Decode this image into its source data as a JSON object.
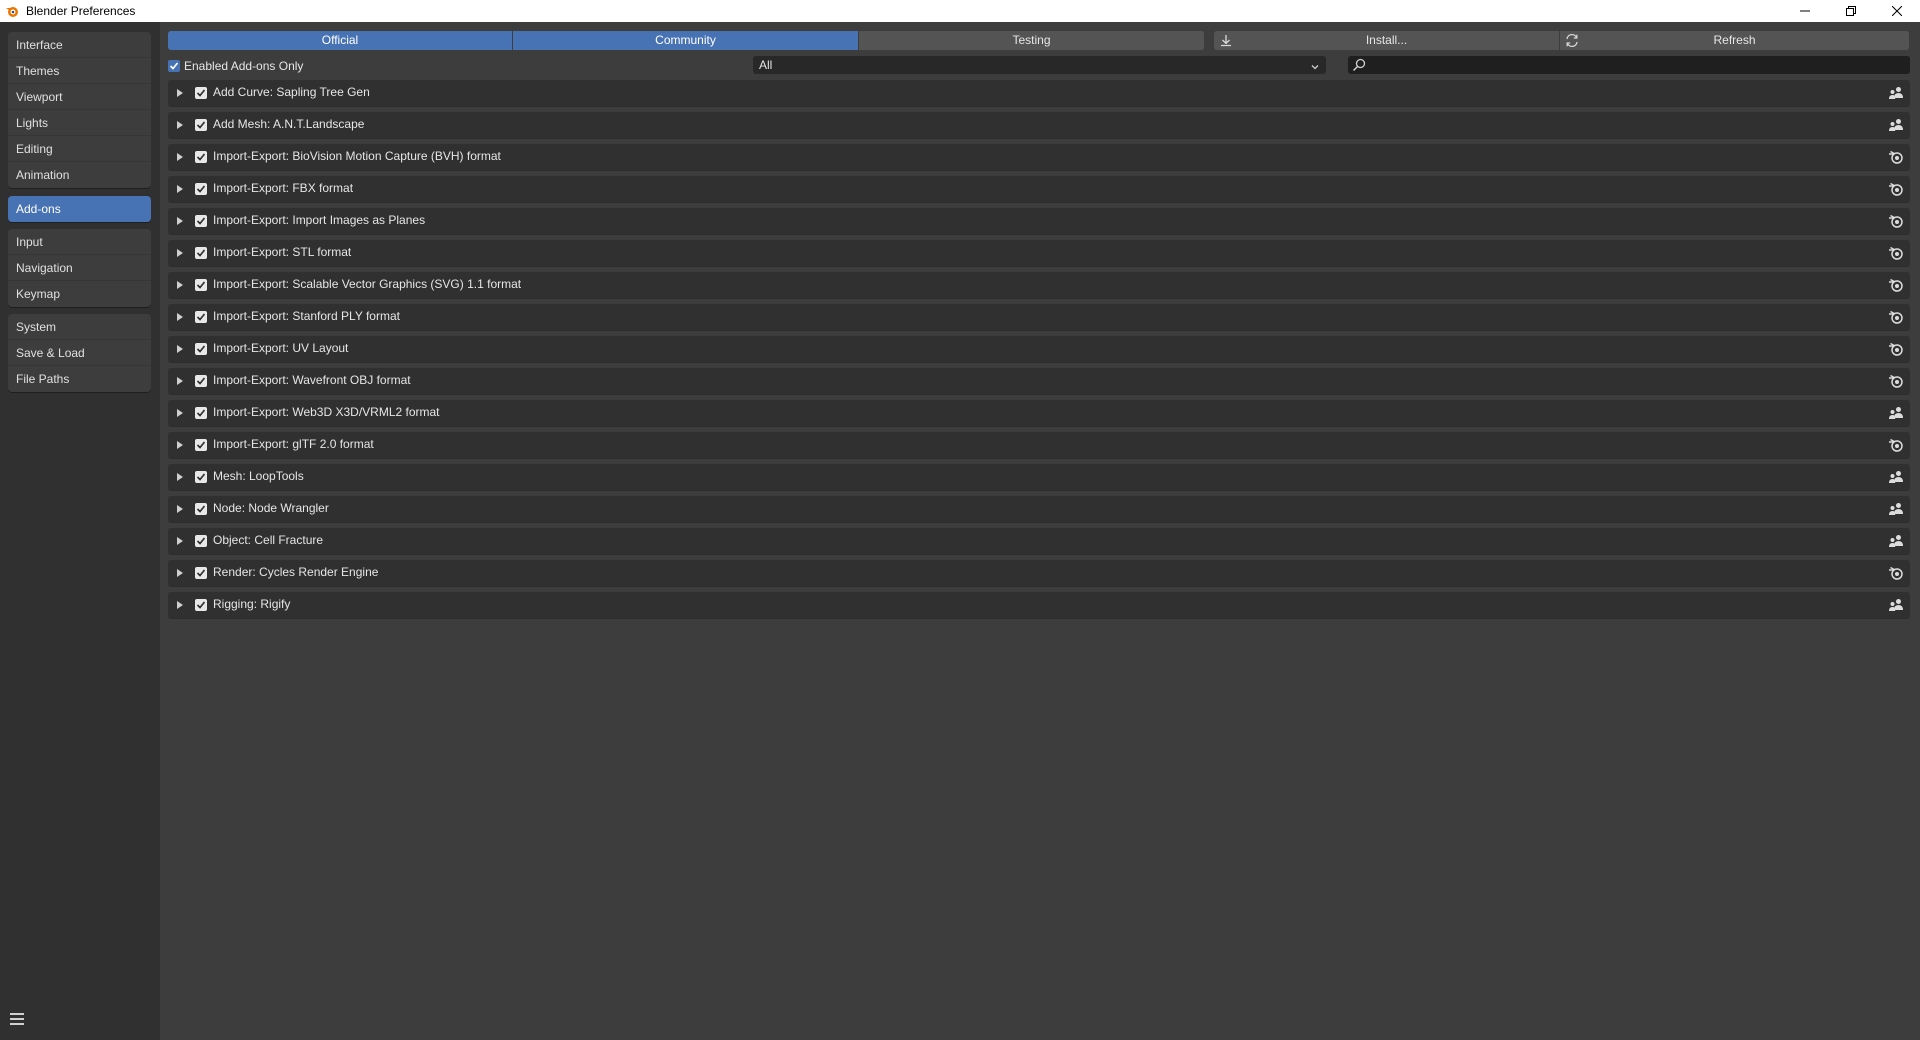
{
  "window": {
    "title": "Blender Preferences"
  },
  "sidebar": {
    "groups": [
      [
        "Interface",
        "Themes",
        "Viewport",
        "Lights",
        "Editing",
        "Animation"
      ],
      [
        "Add-ons"
      ],
      [
        "Input",
        "Navigation",
        "Keymap"
      ],
      [
        "System",
        "Save & Load",
        "File Paths"
      ]
    ],
    "active": "Add-ons"
  },
  "toolbar": {
    "tabs": [
      "Official",
      "Community",
      "Testing"
    ],
    "active_tabs": [
      "Official",
      "Community"
    ],
    "install_label": "Install...",
    "refresh_label": "Refresh"
  },
  "filter": {
    "enabled_only_label": "Enabled Add-ons Only",
    "enabled_only_checked": true,
    "category_value": "All",
    "search_value": ""
  },
  "addons": [
    {
      "name": "Add Curve: Sapling Tree Gen",
      "enabled": true,
      "support": "community"
    },
    {
      "name": "Add Mesh: A.N.T.Landscape",
      "enabled": true,
      "support": "community"
    },
    {
      "name": "Import-Export: BioVision Motion Capture (BVH) format",
      "enabled": true,
      "support": "official"
    },
    {
      "name": "Import-Export: FBX format",
      "enabled": true,
      "support": "official"
    },
    {
      "name": "Import-Export: Import Images as Planes",
      "enabled": true,
      "support": "official"
    },
    {
      "name": "Import-Export: STL format",
      "enabled": true,
      "support": "official"
    },
    {
      "name": "Import-Export: Scalable Vector Graphics (SVG) 1.1 format",
      "enabled": true,
      "support": "official"
    },
    {
      "name": "Import-Export: Stanford PLY format",
      "enabled": true,
      "support": "official"
    },
    {
      "name": "Import-Export: UV Layout",
      "enabled": true,
      "support": "official"
    },
    {
      "name": "Import-Export: Wavefront OBJ format",
      "enabled": true,
      "support": "official"
    },
    {
      "name": "Import-Export: Web3D X3D/VRML2 format",
      "enabled": true,
      "support": "community"
    },
    {
      "name": "Import-Export: glTF 2.0 format",
      "enabled": true,
      "support": "official"
    },
    {
      "name": "Mesh: LoopTools",
      "enabled": true,
      "support": "community"
    },
    {
      "name": "Node: Node Wrangler",
      "enabled": true,
      "support": "community"
    },
    {
      "name": "Object: Cell Fracture",
      "enabled": true,
      "support": "community"
    },
    {
      "name": "Render: Cycles Render Engine",
      "enabled": true,
      "support": "official"
    },
    {
      "name": "Rigging: Rigify",
      "enabled": true,
      "support": "community"
    }
  ],
  "colors": {
    "accent": "#4772b3",
    "panel": "#3d3d3d",
    "sidebar": "#303030",
    "row": "#303030"
  }
}
